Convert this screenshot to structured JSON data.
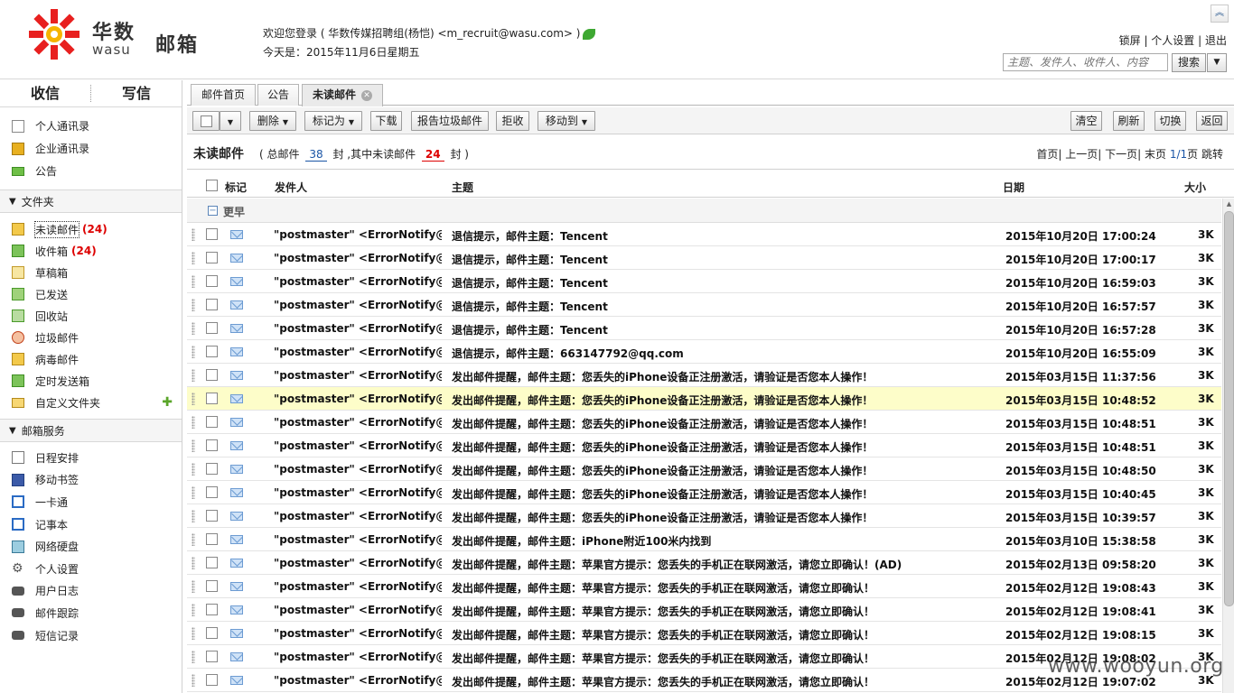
{
  "brand": {
    "name_cn": "华数",
    "name_en": "wasu",
    "product": "邮箱",
    "colors": {
      "red": "#e8201f",
      "yellow": "#f6b400",
      "text": "#333333"
    }
  },
  "header": {
    "welcome": "欢迎您登录 ( 华数传媒招聘组(杨恺)  <m_recruit@wasu.com> )",
    "today": "今天是：2015年11月6日星期五",
    "links": [
      "锁屏",
      "个人设置",
      "退出"
    ],
    "link_sep": " | ",
    "search_placeholder": "主题、发件人、收件人、内容",
    "search_button": "搜索",
    "collapse_icon": "chevron-up-icon"
  },
  "sidebar": {
    "receive": "收信",
    "compose": "写信",
    "top_items": [
      {
        "label": "个人通讯录",
        "icon": "address-book-icon"
      },
      {
        "label": "企业通讯录",
        "icon": "company-contacts-icon"
      },
      {
        "label": "公告",
        "icon": "announcement-icon"
      }
    ],
    "folders_title": "文件夹",
    "folders": [
      {
        "label": "未读邮件",
        "count": "(24)",
        "icon": "unread-folder-icon"
      },
      {
        "label": "收件箱",
        "count": "(24)",
        "icon": "inbox-icon"
      },
      {
        "label": "草稿箱",
        "count": "",
        "icon": "drafts-icon"
      },
      {
        "label": "已发送",
        "count": "",
        "icon": "sent-icon"
      },
      {
        "label": "回收站",
        "count": "",
        "icon": "recycle-bin-icon"
      },
      {
        "label": "垃圾邮件",
        "count": "",
        "icon": "spam-icon"
      },
      {
        "label": "病毒邮件",
        "count": "",
        "icon": "virus-icon"
      },
      {
        "label": "定时发送箱",
        "count": "",
        "icon": "scheduled-icon"
      },
      {
        "label": "自定义文件夹",
        "count": "",
        "icon": "custom-folder-icon"
      }
    ],
    "services_title": "邮箱服务",
    "services": [
      {
        "label": "日程安排",
        "icon": "calendar-icon"
      },
      {
        "label": "移动书签",
        "icon": "bookmark-icon"
      },
      {
        "label": "一卡通",
        "icon": "card-icon"
      },
      {
        "label": "记事本",
        "icon": "notepad-icon"
      },
      {
        "label": "网络硬盘",
        "icon": "disk-icon"
      },
      {
        "label": "个人设置",
        "icon": "gear-icon"
      },
      {
        "label": "用户日志",
        "icon": "binoculars-icon"
      },
      {
        "label": "邮件跟踪",
        "icon": "binoculars-icon"
      },
      {
        "label": "短信记录",
        "icon": "binoculars-icon"
      }
    ]
  },
  "tabs": [
    {
      "label": "邮件首页"
    },
    {
      "label": "公告"
    },
    {
      "label": "未读邮件",
      "active": true
    }
  ],
  "toolbar": {
    "delete": "删除",
    "mark": "标记为",
    "download": "下载",
    "report_spam": "报告垃圾邮件",
    "reject": "拒收",
    "move": "移动到",
    "clear": "清空",
    "refresh": "刷新",
    "switch": "切换",
    "back": "返回"
  },
  "folder_view": {
    "title": "未读邮件",
    "stats_prefix": "( 总邮件",
    "total": "38",
    "stats_mid": "封 ,其中未读邮件",
    "unread": "24",
    "stats_suffix": "封 )",
    "pager": {
      "first": "首页",
      "prev": "上一页",
      "next": "下一页",
      "last": "末页",
      "page": "1/1",
      "page_suffix": "页",
      "jump": "跳转"
    }
  },
  "columns": {
    "flag": "标记",
    "from": "发件人",
    "subject": "主题",
    "date": "日期",
    "size": "大小"
  },
  "group_label": "更早",
  "emails": [
    {
      "from": "\"postmaster\" <ErrorNotify@g...",
      "subject": "退信提示，邮件主题：Tencent",
      "date": "2015年10月20日 17:00:24",
      "size": "3K"
    },
    {
      "from": "\"postmaster\" <ErrorNotify@g...",
      "subject": "退信提示，邮件主题：Tencent",
      "date": "2015年10月20日 17:00:17",
      "size": "3K"
    },
    {
      "from": "\"postmaster\" <ErrorNotify@g...",
      "subject": "退信提示，邮件主题：Tencent",
      "date": "2015年10月20日 16:59:03",
      "size": "3K"
    },
    {
      "from": "\"postmaster\" <ErrorNotify@g...",
      "subject": "退信提示，邮件主题：Tencent",
      "date": "2015年10月20日 16:57:57",
      "size": "3K"
    },
    {
      "from": "\"postmaster\" <ErrorNotify@g...",
      "subject": "退信提示，邮件主题：Tencent",
      "date": "2015年10月20日 16:57:28",
      "size": "3K"
    },
    {
      "from": "\"postmaster\" <ErrorNotify@g...",
      "subject": "退信提示，邮件主题：663147792@qq.com",
      "date": "2015年10月20日 16:55:09",
      "size": "3K"
    },
    {
      "from": "\"postmaster\" <ErrorNotify@g...",
      "subject": "发出邮件提醒，邮件主题：您丢失的iPhone设备正注册激活，请验证是否您本人操作！",
      "date": "2015年03月15日 11:37:56",
      "size": "3K"
    },
    {
      "from": "\"postmaster\" <ErrorNotify@tu...",
      "subject": "发出邮件提醒，邮件主题：您丢失的iPhone设备正注册激活，请验证是否您本人操作！",
      "date": "2015年03月15日 10:48:52",
      "size": "3K",
      "highlight": true
    },
    {
      "from": "\"postmaster\" <ErrorNotify@tu...",
      "subject": "发出邮件提醒，邮件主题：您丢失的iPhone设备正注册激活，请验证是否您本人操作！",
      "date": "2015年03月15日 10:48:51",
      "size": "3K"
    },
    {
      "from": "\"postmaster\" <ErrorNotify@tu...",
      "subject": "发出邮件提醒，邮件主题：您丢失的iPhone设备正注册激活，请验证是否您本人操作！",
      "date": "2015年03月15日 10:48:51",
      "size": "3K"
    },
    {
      "from": "\"postmaster\" <ErrorNotify@tu...",
      "subject": "发出邮件提醒，邮件主题：您丢失的iPhone设备正注册激活，请验证是否您本人操作！",
      "date": "2015年03月15日 10:48:50",
      "size": "3K"
    },
    {
      "from": "\"postmaster\" <ErrorNotify@tu...",
      "subject": "发出邮件提醒，邮件主题：您丢失的iPhone设备正注册激活，请验证是否您本人操作！",
      "date": "2015年03月15日 10:40:45",
      "size": "3K"
    },
    {
      "from": "\"postmaster\" <ErrorNotify@tu...",
      "subject": "发出邮件提醒，邮件主题：您丢失的iPhone设备正注册激活，请验证是否您本人操作！",
      "date": "2015年03月15日 10:39:57",
      "size": "3K"
    },
    {
      "from": "\"postmaster\" <ErrorNotify@tu...",
      "subject": "发出邮件提醒，邮件主题：iPhone附近100米内找到",
      "date": "2015年03月10日 15:38:58",
      "size": "3K"
    },
    {
      "from": "\"postmaster\" <ErrorNotify@tu...",
      "subject": "发出邮件提醒，邮件主题：苹果官方提示：您丢失的手机正在联网激活，请您立即确认！(AD)",
      "date": "2015年02月13日 09:58:20",
      "size": "3K"
    },
    {
      "from": "\"postmaster\" <ErrorNotify@tu...",
      "subject": "发出邮件提醒，邮件主题：苹果官方提示：您丢失的手机正在联网激活，请您立即确认！",
      "date": "2015年02月12日 19:08:43",
      "size": "3K"
    },
    {
      "from": "\"postmaster\" <ErrorNotify@tu...",
      "subject": "发出邮件提醒，邮件主题：苹果官方提示：您丢失的手机正在联网激活，请您立即确认！",
      "date": "2015年02月12日 19:08:41",
      "size": "3K"
    },
    {
      "from": "\"postmaster\" <ErrorNotify@tu...",
      "subject": "发出邮件提醒，邮件主题：苹果官方提示：您丢失的手机正在联网激活，请您立即确认！",
      "date": "2015年02月12日 19:08:15",
      "size": "3K"
    },
    {
      "from": "\"postmaster\" <ErrorNotify@tu...",
      "subject": "发出邮件提醒，邮件主题：苹果官方提示：您丢失的手机正在联网激活，请您立即确认！",
      "date": "2015年02月12日 19:08:02",
      "size": "3K"
    },
    {
      "from": "\"postmaster\" <ErrorNotify@tu...",
      "subject": "发出邮件提醒，邮件主题：苹果官方提示：您丢失的手机正在联网激活，请您立即确认！",
      "date": "2015年02月12日 19:07:02",
      "size": "3K"
    }
  ],
  "watermark": "www.wooyun.org"
}
